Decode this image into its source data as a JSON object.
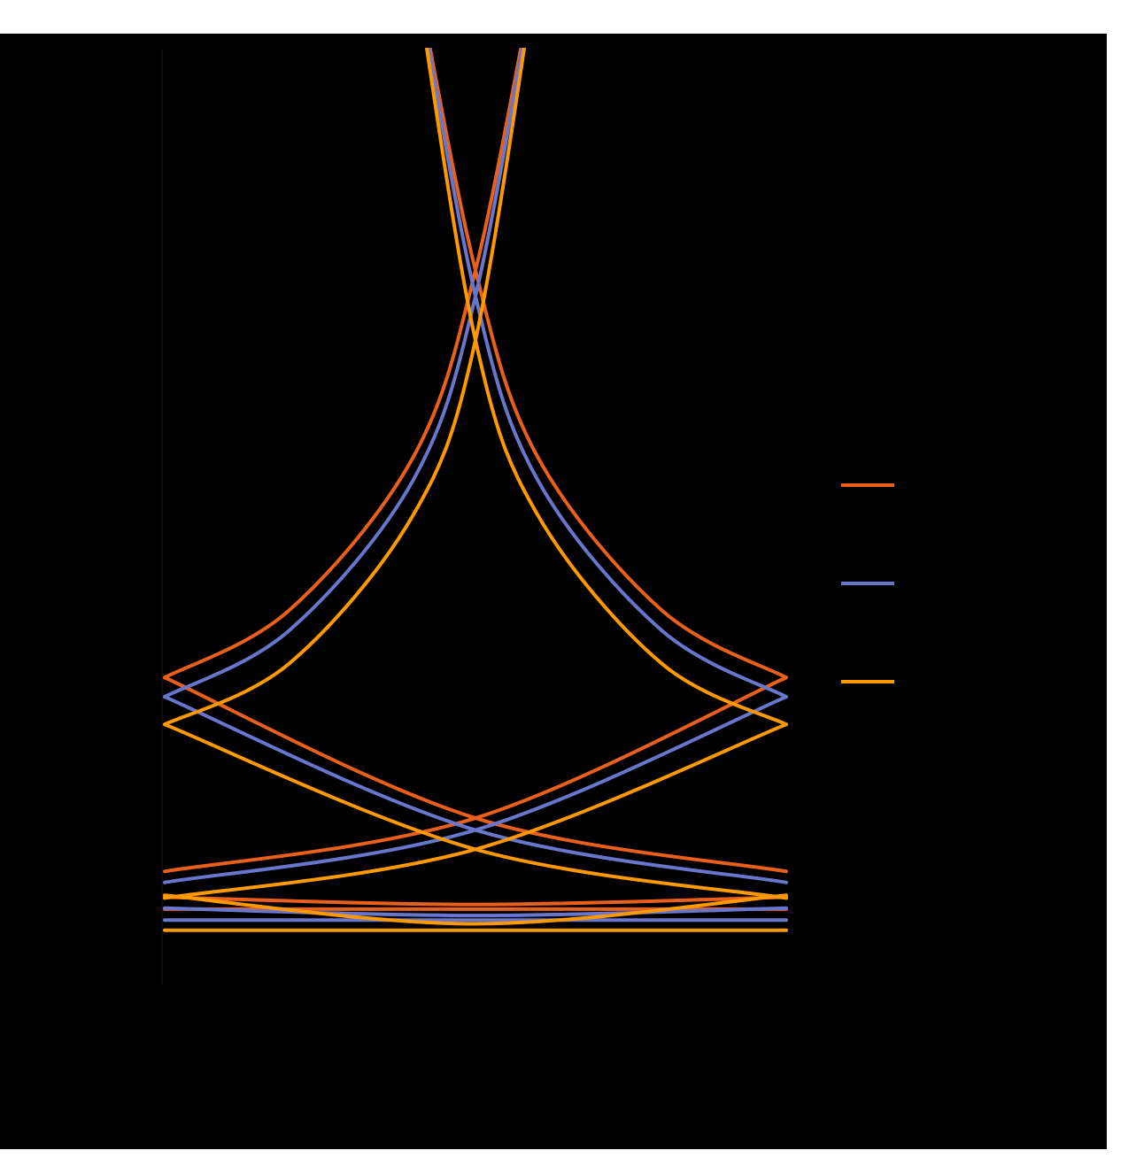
{
  "chart_data": {
    "type": "line",
    "title": "",
    "xlabel": "",
    "ylabel": "",
    "x_range": [
      0,
      1
    ],
    "y_range": [
      0,
      10
    ],
    "legend_placement": "right",
    "grid": false,
    "series": [
      {
        "color": "#e8601c",
        "y_left": 3.09,
        "y_right": 3.09,
        "y_min": 0.68,
        "x_min": 0.5,
        "rise_left": 0.4,
        "rise_right": 0.4,
        "x_cross": 0.5,
        "curves": [
          {
            "kind": "rising",
            "values": [
              {
                "x": 0.0,
                "y": 3.09
              },
              {
                "x": 0.2,
                "y": 3.82
              },
              {
                "x": 0.4,
                "y": 5.49
              },
              {
                "x": 0.5,
                "y": 7.52
              },
              {
                "x": 0.6,
                "y": 10.9
              }
            ]
          },
          {
            "kind": "falling",
            "values": [
              {
                "x": 0.4,
                "y": 10.9
              },
              {
                "x": 0.5,
                "y": 7.52
              },
              {
                "x": 0.6,
                "y": 5.49
              },
              {
                "x": 0.8,
                "y": 3.82
              },
              {
                "x": 1.0,
                "y": 3.09
              }
            ]
          },
          {
            "kind": "rising-low",
            "values": [
              {
                "x": 0.0,
                "y": 0.98
              },
              {
                "x": 0.5,
                "y": 1.56
              },
              {
                "x": 1.0,
                "y": 3.09
              }
            ]
          },
          {
            "kind": "falling-low",
            "values": [
              {
                "x": 0.0,
                "y": 3.09
              },
              {
                "x": 0.5,
                "y": 1.56
              },
              {
                "x": 1.0,
                "y": 0.98
              }
            ]
          },
          {
            "kind": "bowl",
            "values": [
              {
                "x": 0.0,
                "y": 0.7
              },
              {
                "x": 0.5,
                "y": 0.62
              },
              {
                "x": 1.0,
                "y": 0.7
              }
            ]
          },
          {
            "kind": "flat",
            "values": [
              {
                "x": 0.0,
                "y": 0.57
              },
              {
                "x": 1.0,
                "y": 0.57
              }
            ]
          }
        ]
      },
      {
        "color": "#6876cc",
        "curves": [
          {
            "kind": "rising",
            "values": [
              {
                "x": 0.0,
                "y": 2.88
              },
              {
                "x": 0.2,
                "y": 3.6
              },
              {
                "x": 0.4,
                "y": 5.24
              },
              {
                "x": 0.5,
                "y": 7.24
              },
              {
                "x": 0.6,
                "y": 10.9
              }
            ]
          },
          {
            "kind": "falling",
            "values": [
              {
                "x": 0.4,
                "y": 10.9
              },
              {
                "x": 0.5,
                "y": 7.24
              },
              {
                "x": 0.6,
                "y": 5.24
              },
              {
                "x": 0.8,
                "y": 3.6
              },
              {
                "x": 1.0,
                "y": 2.88
              }
            ]
          },
          {
            "kind": "rising-low",
            "values": [
              {
                "x": 0.0,
                "y": 0.86
              },
              {
                "x": 0.5,
                "y": 1.43
              },
              {
                "x": 1.0,
                "y": 2.88
              }
            ]
          },
          {
            "kind": "falling-low",
            "values": [
              {
                "x": 0.0,
                "y": 2.88
              },
              {
                "x": 0.5,
                "y": 1.43
              },
              {
                "x": 1.0,
                "y": 0.86
              }
            ]
          },
          {
            "kind": "bowl",
            "values": [
              {
                "x": 0.0,
                "y": 0.58
              },
              {
                "x": 0.5,
                "y": 0.5
              },
              {
                "x": 1.0,
                "y": 0.58
              }
            ]
          },
          {
            "kind": "flat",
            "values": [
              {
                "x": 0.0,
                "y": 0.45
              },
              {
                "x": 1.0,
                "y": 0.45
              }
            ]
          }
        ]
      },
      {
        "color": "#ff9900",
        "curves": [
          {
            "kind": "rising",
            "values": [
              {
                "x": 0.0,
                "y": 2.58
              },
              {
                "x": 0.2,
                "y": 3.24
              },
              {
                "x": 0.4,
                "y": 4.86
              },
              {
                "x": 0.5,
                "y": 6.76
              },
              {
                "x": 0.6,
                "y": 10.9
              }
            ]
          },
          {
            "kind": "falling",
            "values": [
              {
                "x": 0.4,
                "y": 10.9
              },
              {
                "x": 0.5,
                "y": 6.76
              },
              {
                "x": 0.6,
                "y": 4.86
              },
              {
                "x": 0.8,
                "y": 3.24
              },
              {
                "x": 1.0,
                "y": 2.58
              }
            ]
          },
          {
            "kind": "rising-low",
            "values": [
              {
                "x": 0.0,
                "y": 0.69
              },
              {
                "x": 0.5,
                "y": 1.22
              },
              {
                "x": 1.0,
                "y": 2.58
              }
            ]
          },
          {
            "kind": "falling-low",
            "values": [
              {
                "x": 0.0,
                "y": 2.58
              },
              {
                "x": 0.5,
                "y": 1.22
              },
              {
                "x": 1.0,
                "y": 0.69
              }
            ]
          },
          {
            "kind": "bowl",
            "values": [
              {
                "x": 0.0,
                "y": 0.72
              },
              {
                "x": 0.5,
                "y": 0.41
              },
              {
                "x": 1.0,
                "y": 0.72
              }
            ]
          },
          {
            "kind": "flat",
            "values": [
              {
                "x": 0.0,
                "y": 0.34
              },
              {
                "x": 1.0,
                "y": 0.34
              }
            ]
          }
        ]
      }
    ]
  },
  "legend": {
    "items": [
      {
        "color": "#e8601c"
      },
      {
        "color": "#6876cc"
      },
      {
        "color": "#ff9900"
      }
    ]
  }
}
